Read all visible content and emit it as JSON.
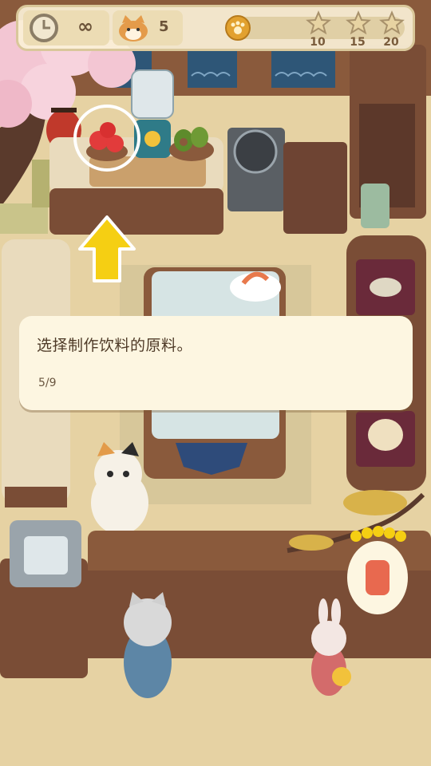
{
  "hud": {
    "timer_value": "∞",
    "shiba_count": "5",
    "star_goals": [
      "10",
      "15",
      "20"
    ],
    "progress_fraction": 0.03
  },
  "tutorial": {
    "message": "选择制作饮料的原料。",
    "step": "5/9"
  },
  "colors": {
    "dialog_bg": "#fdf6e1",
    "arrow": "#f5cf13",
    "progress_fill": "#d8a53c",
    "wood": "#7a4d36"
  }
}
